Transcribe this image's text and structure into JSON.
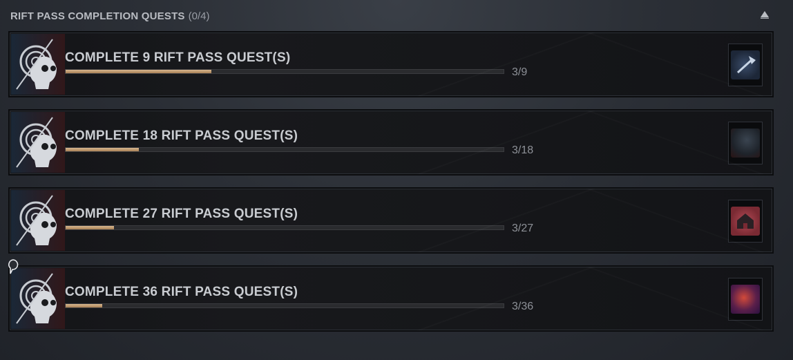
{
  "header": {
    "title": "RIFT PASS COMPLETION QUESTS",
    "count": "(0/4)"
  },
  "quests": [
    {
      "title": "COMPLETE 9 RIFT PASS QUEST(S)",
      "progress": "3/9",
      "fraction": 0.333,
      "reward_icon": "axe-icon"
    },
    {
      "title": "COMPLETE 18 RIFT PASS QUEST(S)",
      "progress": "3/18",
      "fraction": 0.167,
      "reward_icon": "landscape-icon"
    },
    {
      "title": "COMPLETE 27 RIFT PASS QUEST(S)",
      "progress": "3/27",
      "fraction": 0.111,
      "reward_icon": "house-icon"
    },
    {
      "title": "COMPLETE 36 RIFT PASS QUEST(S)",
      "progress": "3/36",
      "fraction": 0.083,
      "reward_icon": "charm-icon"
    }
  ],
  "colors": {
    "progress_fill": "#c9a57a",
    "accent_red": "#7a1a1a",
    "accent_blue": "#2b5a8a"
  }
}
